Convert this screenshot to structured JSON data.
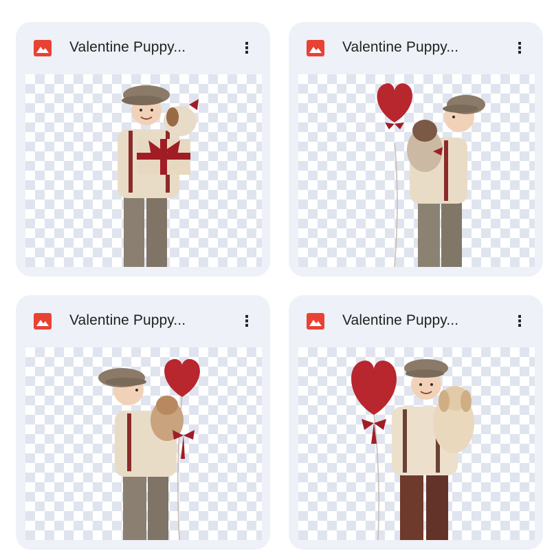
{
  "files": [
    {
      "title": "Valentine Puppy...",
      "icon": "image-file-icon",
      "menu_icon": "more-vert-icon",
      "menu_glyph": "⋮"
    },
    {
      "title": "Valentine Puppy...",
      "icon": "image-file-icon",
      "menu_icon": "more-vert-icon",
      "menu_glyph": "⋮"
    },
    {
      "title": "Valentine Puppy...",
      "icon": "image-file-icon",
      "menu_icon": "more-vert-icon",
      "menu_glyph": "⋮"
    },
    {
      "title": "Valentine Puppy...",
      "icon": "image-file-icon",
      "menu_icon": "more-vert-icon",
      "menu_glyph": "⋮"
    }
  ],
  "colors": {
    "card_bg": "#eef1f7",
    "file_icon": "#e94235",
    "checker": "#dfe4ee",
    "balloon": "#b8262e",
    "bow": "#a01d26"
  }
}
